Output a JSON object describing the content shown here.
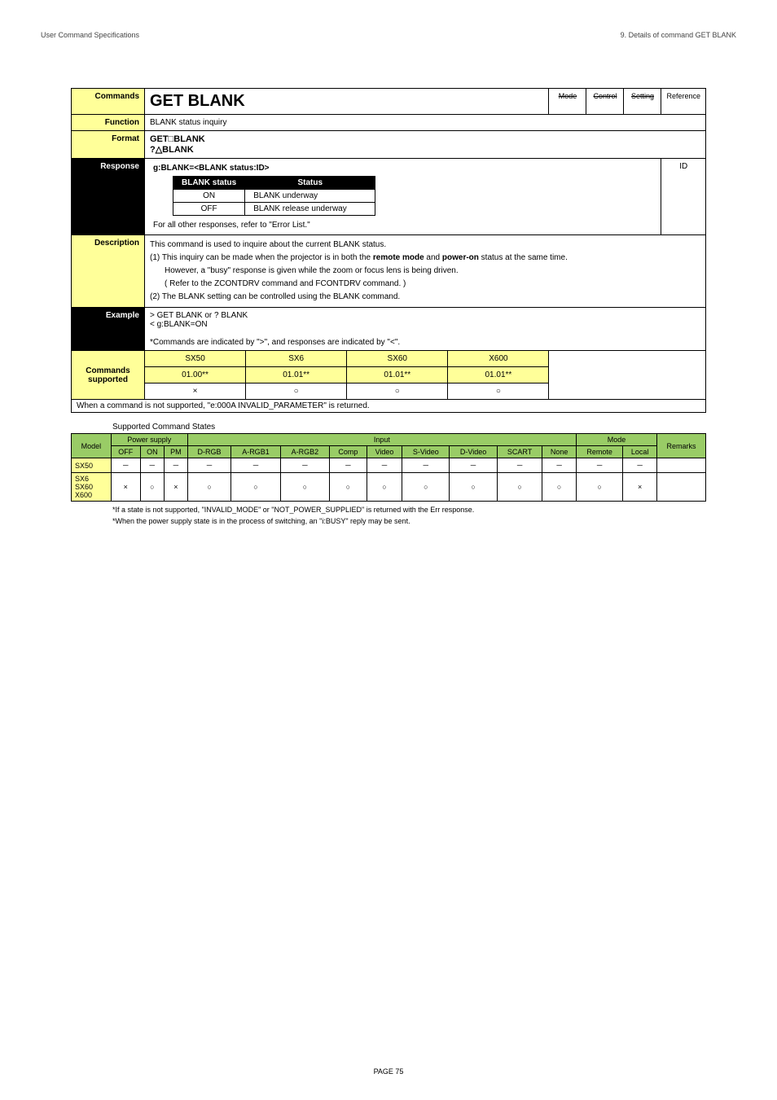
{
  "header": {
    "left": "User Command Specifications",
    "right": "9. Details of command GET BLANK"
  },
  "labels": {
    "commands": "Commands",
    "function": "Function",
    "format": "Format",
    "response": "Response",
    "description": "Description",
    "example": "Example",
    "commands_supported": "Commands supported",
    "mode": "Mode",
    "control": "Control",
    "setting": "Setting",
    "reference": "Reference",
    "id": "ID"
  },
  "cmd_title": "GET BLANK",
  "function_text": "BLANK status inquiry",
  "format_lines": [
    "GET□BLANK",
    "?△BLANK"
  ],
  "response": {
    "header_line": "g:BLANK=<BLANK status:ID>",
    "status_header_blank": "BLANK status",
    "status_header_status": "Status",
    "rows": [
      {
        "k": "ON",
        "v": "BLANK underway"
      },
      {
        "k": "OFF",
        "v": "BLANK release underway"
      }
    ],
    "footer": "For all other responses, refer to \"Error List.\""
  },
  "description_lines": [
    "This command is used to inquire about the current BLANK status.",
    "",
    "(1) This inquiry can be made when the projector is in both the <b>remote mode</b> and <b>power-on</b> status at the same time.",
    "However, a \"busy\" response is given while the zoom or focus lens is being driven.",
    "( Refer to the ZCONTDRV command and FCONTDRV command. )",
    "(2) The BLANK setting can be controlled using the BLANK command."
  ],
  "example_lines": [
    "> GET BLANK or ? BLANK",
    "< g:BLANK=ON",
    "",
    "*Commands are indicated by \">\", and responses are indicated by \"<\"."
  ],
  "supported": {
    "headers": [
      "SX50",
      "SX6",
      "SX60",
      "X600"
    ],
    "values": [
      "01.00**",
      "01.01**",
      "01.01**",
      "01.01**"
    ],
    "row2": [
      "×",
      "○",
      "○",
      "○"
    ],
    "note": "When a command is not supported, \"e:000A INVALID_PARAMETER\" is returned."
  },
  "states_title": "Supported Command States",
  "states": {
    "group_headers": {
      "model": "Model",
      "power": "Power supply",
      "input": "Input",
      "mode": "Mode",
      "remarks": "Remarks"
    },
    "sub_headers": [
      "OFF",
      "ON",
      "PM",
      "D-RGB",
      "A-RGB1",
      "A-RGB2",
      "Comp",
      "Video",
      "S-Video",
      "D-Video",
      "SCART",
      "None",
      "Remote",
      "Local"
    ],
    "rows": [
      {
        "model": "SX50",
        "cells": [
          "－",
          "－",
          "－",
          "－",
          "－",
          "－",
          "－",
          "－",
          "－",
          "－",
          "－",
          "－",
          "－",
          "－"
        ],
        "remarks": ""
      },
      {
        "model": "SX6\nSX60\nX600",
        "cells": [
          "×",
          "○",
          "×",
          "○",
          "○",
          "○",
          "○",
          "○",
          "○",
          "○",
          "○",
          "○",
          "○",
          "×"
        ],
        "remarks": ""
      }
    ]
  },
  "footnotes": [
    "*If a state is not supported, \"INVALID_MODE\" or \"NOT_POWER_SUPPLIED\" is returned with the Err response.",
    "*When the power supply state is in the process of switching, an \"i:BUSY\" reply may be sent."
  ],
  "footer": "PAGE 75"
}
